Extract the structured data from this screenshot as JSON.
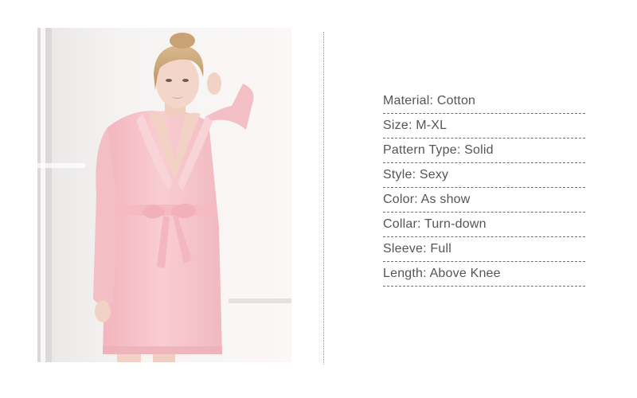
{
  "product_image": {
    "subject": "model-wearing-pink-robe"
  },
  "specs": [
    {
      "label": "Material",
      "value": "Cotton"
    },
    {
      "label": "Size",
      "value": "M-XL"
    },
    {
      "label": "Pattern Type",
      "value": "Solid"
    },
    {
      "label": "Style",
      "value": "Sexy"
    },
    {
      "label": "Color",
      "value": "As show"
    },
    {
      "label": "Collar",
      "value": "Turn-down"
    },
    {
      "label": "Sleeve",
      "value": "Full"
    },
    {
      "label": "Length",
      "value": "Above Knee"
    }
  ],
  "colors": {
    "robe": "#f7c6cc",
    "text": "#555555",
    "divider": "#9a9a9a"
  }
}
